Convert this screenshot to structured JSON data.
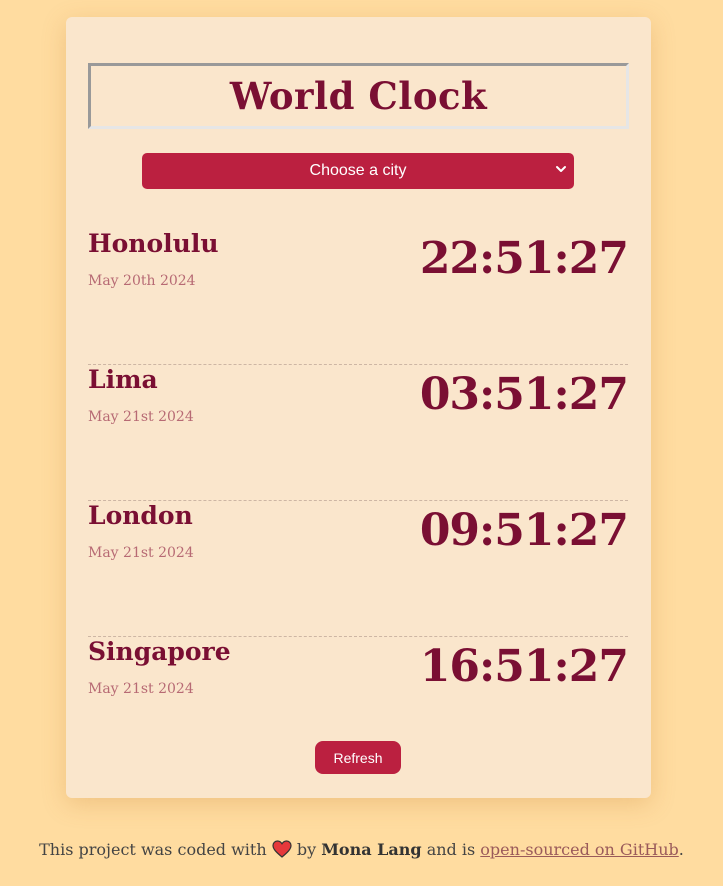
{
  "app": {
    "title": "World Clock",
    "select_placeholder": "Choose a city",
    "refresh_label": "Refresh"
  },
  "cities": [
    {
      "name": "Honolulu",
      "date": "May 20th 2024",
      "time": "22:51:27"
    },
    {
      "name": "Lima",
      "date": "May 21st 2024",
      "time": "03:51:27"
    },
    {
      "name": "London",
      "date": "May 21st 2024",
      "time": "09:51:27"
    },
    {
      "name": "Singapore",
      "date": "May 21st 2024",
      "time": "16:51:27"
    }
  ],
  "footer": {
    "prefix": "This project was coded with",
    "heart_icon": "heart-icon",
    "by": "by",
    "author": "Mona Lang",
    "middle": "and is",
    "link_text": "open-sourced on GitHub",
    "suffix": "."
  },
  "colors": {
    "page_bg": "#ffdca0",
    "card_bg": "#fae6cc",
    "accent": "#bb2040",
    "text_primary": "#7a0f33",
    "date_text": "#b76a74"
  }
}
